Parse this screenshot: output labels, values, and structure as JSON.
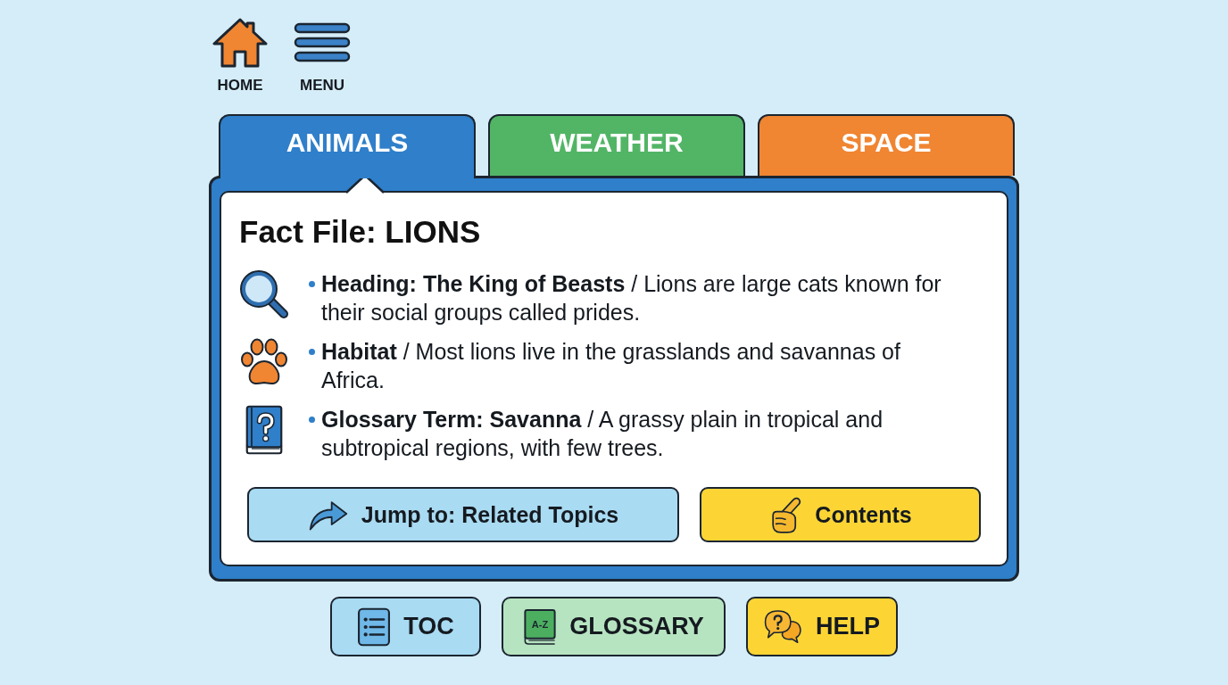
{
  "top_nav": [
    {
      "kind": "home",
      "label": "HOME"
    },
    {
      "kind": "menu",
      "label": "MENU"
    }
  ],
  "tabs": [
    {
      "label": "ANIMALS",
      "selected": true,
      "color": "#2f7fca"
    },
    {
      "label": "WEATHER",
      "selected": false,
      "color": "#52b566"
    },
    {
      "label": "SPACE",
      "selected": false,
      "color": "#f08532"
    }
  ],
  "fact_file": {
    "title": "Fact File: LIONS",
    "items": [
      {
        "kind": "search",
        "text": "**Heading: The King of Beasts** / Lions are large cats known for their social groups called prides."
      },
      {
        "kind": "paw",
        "text": "**Habitat** / Most lions live in the grasslands and savannas of Africa."
      },
      {
        "kind": "book",
        "text": "**Glossary Term: Savanna** / A grassy plain in tropical and subtropical regions, with few trees."
      }
    ],
    "actions": [
      {
        "kind": "jump",
        "label": "Jump to: Related Topics"
      },
      {
        "kind": "pointer",
        "label": "Contents"
      }
    ]
  },
  "bottom_buttons": [
    {
      "kind": "toc",
      "label": "TOC"
    },
    {
      "kind": "glossary",
      "label": "GLOSSARY",
      "icon_text": "A-Z"
    },
    {
      "kind": "help",
      "label": "HELP"
    }
  ]
}
